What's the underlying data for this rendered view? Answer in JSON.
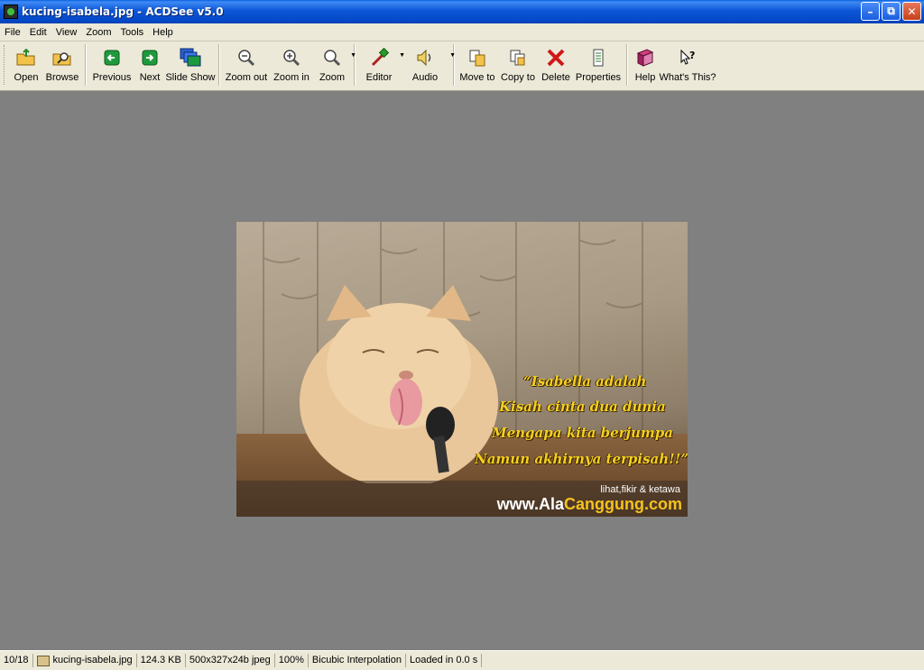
{
  "window": {
    "title": "kucing-isabela.jpg - ACDSee v5.0"
  },
  "menu": [
    "File",
    "Edit",
    "View",
    "Zoom",
    "Tools",
    "Help"
  ],
  "toolbar": {
    "open": "Open",
    "browse": "Browse",
    "previous": "Previous",
    "next": "Next",
    "slideshow": "Slide Show",
    "zoomout": "Zoom out",
    "zoomin": "Zoom in",
    "zoom": "Zoom",
    "editor": "Editor",
    "audio": "Audio",
    "moveto": "Move to",
    "copyto": "Copy to",
    "delete": "Delete",
    "properties": "Properties",
    "help": "Help",
    "whatsthis": "What's This?"
  },
  "image": {
    "caption": [
      "“Isabella adalah",
      "Kisah cinta dua dunia",
      "Mengapa kita berjumpa",
      "Namun akhirnya terpisah!!”"
    ],
    "tagline": "lihat,fikir & ketawa",
    "site_prefix": "www.Ala",
    "site_accent": "Canggung.com"
  },
  "status": {
    "index": "10/18",
    "filename": "kucing-isabela.jpg",
    "size": "124.3 KB",
    "dims": "500x327x24b jpeg",
    "zoom": "100%",
    "interp": "Bicubic Interpolation",
    "loaded": "Loaded in 0.0 s"
  },
  "colors": {
    "titlebar": "#0a5fe0",
    "viewer_bg": "#808080",
    "caption": "#f5d021"
  }
}
